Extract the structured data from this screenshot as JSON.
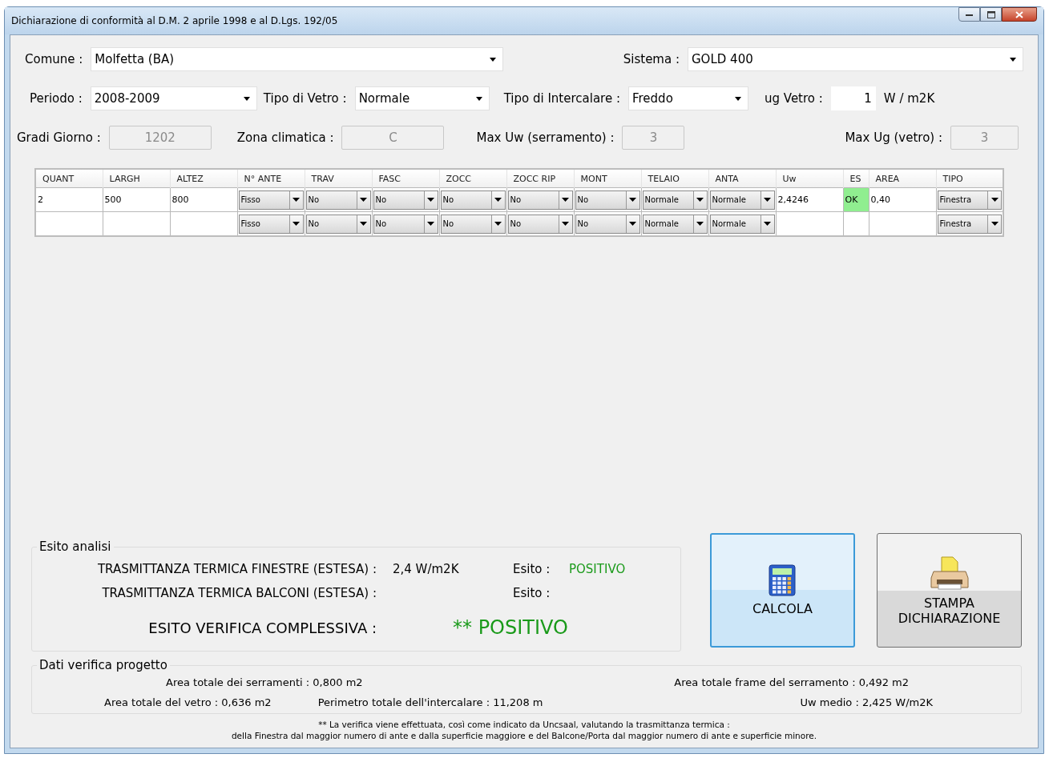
{
  "window": {
    "title": "Dichiarazione di conformità al D.M. 2 aprile 1998 e al D.Lgs. 192/05"
  },
  "form": {
    "comune": {
      "label": "Comune :",
      "value": "Molfetta (BA)"
    },
    "sistema": {
      "label": "Sistema :",
      "value": "GOLD 400"
    },
    "periodo": {
      "label": "Periodo :",
      "value": "2008-2009"
    },
    "tipo_vetro": {
      "label": "Tipo di Vetro :",
      "value": "Normale"
    },
    "tipo_intercalare": {
      "label": "Tipo di Intercalare :",
      "value": "Freddo"
    },
    "ug_vetro": {
      "label": "ug Vetro :",
      "value": "1",
      "unit": "W / m2K"
    },
    "gradi_giorno": {
      "label": "Gradi Giorno :",
      "value": "1202",
      "disabled": true
    },
    "zona_climatica": {
      "label": "Zona climatica :",
      "value": "C",
      "disabled": true
    },
    "max_uw": {
      "label": "Max Uw (serramento) :",
      "value": "3",
      "disabled": true
    },
    "max_ug": {
      "label": "Max Ug (vetro) :",
      "value": "3",
      "disabled": true
    }
  },
  "table": {
    "columns": [
      "QUANT",
      "LARGH",
      "ALTEZ",
      "N° ANTE",
      "TRAV",
      "FASC",
      "ZOCC",
      "ZOCC RIP",
      "MONT",
      "TELAIO",
      "ANTA",
      "Uw",
      "ES",
      "AREA",
      "TIPO"
    ],
    "rows": [
      {
        "cells": [
          {
            "kind": "text",
            "value": "2"
          },
          {
            "kind": "text",
            "value": "500"
          },
          {
            "kind": "text",
            "value": "800"
          },
          {
            "kind": "select",
            "value": "Fisso"
          },
          {
            "kind": "select",
            "value": "No"
          },
          {
            "kind": "select",
            "value": "No"
          },
          {
            "kind": "select",
            "value": "No"
          },
          {
            "kind": "select",
            "value": "No"
          },
          {
            "kind": "select",
            "value": "No"
          },
          {
            "kind": "select",
            "value": "Normale"
          },
          {
            "kind": "select",
            "value": "Normale"
          },
          {
            "kind": "text",
            "value": "2,4246"
          },
          {
            "kind": "status",
            "value": "OK",
            "ok": true
          },
          {
            "kind": "text",
            "value": "0,40"
          },
          {
            "kind": "select",
            "value": "Finestra"
          }
        ]
      },
      {
        "cells": [
          {
            "kind": "empty"
          },
          {
            "kind": "empty"
          },
          {
            "kind": "empty"
          },
          {
            "kind": "select",
            "value": "Fisso"
          },
          {
            "kind": "select",
            "value": "No"
          },
          {
            "kind": "select",
            "value": "No"
          },
          {
            "kind": "select",
            "value": "No"
          },
          {
            "kind": "select",
            "value": "No"
          },
          {
            "kind": "select",
            "value": "No"
          },
          {
            "kind": "select",
            "value": "Normale"
          },
          {
            "kind": "select",
            "value": "Normale"
          },
          {
            "kind": "empty"
          },
          {
            "kind": "empty"
          },
          {
            "kind": "empty"
          },
          {
            "kind": "select",
            "value": "Finestra"
          }
        ]
      }
    ]
  },
  "esito": {
    "title": "Esito analisi",
    "finestre": {
      "label": "TRASMITTANZA TERMICA FINESTRE (ESTESA) :",
      "value": "2,4 W/m2K",
      "esito_label": "Esito :",
      "esito": "POSITIVO"
    },
    "balconi": {
      "label": "TRASMITTANZA TERMICA BALCONI (ESTESA) :",
      "esito_label": "Esito :"
    },
    "complessiva": {
      "label": "ESITO VERIFICA COMPLESSIVA :",
      "value": "** POSITIVO"
    }
  },
  "buttons": [
    {
      "kind": "calc",
      "label": "CALCOLA",
      "focused": true
    },
    {
      "kind": "print",
      "label": "STAMPA DICHIARAZIONE",
      "focused": false
    }
  ],
  "dati": {
    "title": "Dati verifica progetto",
    "area_serramenti": "Area totale dei serramenti : 0,800 m2",
    "area_frame": "Area totale frame del serramento : 0,492 m2",
    "area_vetro": "Area totale del vetro : 0,636 m2",
    "perimetro": "Perimetro totale dell'intercalare : 11,208 m",
    "uw_medio": "Uw medio : 2,425 W/m2K"
  },
  "footnote": [
    "** La verifica viene effettuata, così come indicato da Uncsaal, valutando la trasmittanza termica :",
    "della Finestra dal maggior numero di ante e dalla superficie maggiore e del Balcone/Porta dal maggior numero di ante e superficie minore."
  ]
}
